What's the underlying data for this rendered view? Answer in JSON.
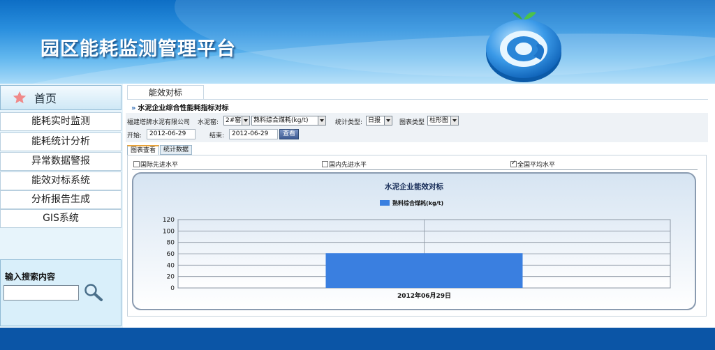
{
  "header": {
    "title": "园区能耗监测管理平台"
  },
  "sidebar": {
    "home_label": "首页",
    "items": [
      {
        "label": "能耗实时监测"
      },
      {
        "label": "能耗统计分析"
      },
      {
        "label": "异常数据警报"
      },
      {
        "label": "能效对标系统"
      },
      {
        "label": "分析报告生成"
      },
      {
        "label": "GIS系统"
      }
    ],
    "search": {
      "label": "输入搜索内容",
      "value": "",
      "placeholder": ""
    }
  },
  "main": {
    "tab_label": "能效对标",
    "subtitle": "水泥企业综合性能耗指标对标",
    "filters": {
      "company": "福建塔牌水泥有限公司",
      "kiln_label": "水泥窑:",
      "kiln_value": "2#窑",
      "indicator_value": "熟料综合煤耗(kg/t)",
      "stat_type_label": "统计类型:",
      "stat_type_value": "日报",
      "chart_type_label": "图表类型",
      "chart_type_value": "柱形图",
      "start_label": "开始:",
      "start_value": "2012-06-29",
      "end_label": "结束:",
      "end_value": "2012-06-29",
      "query_button": "查看"
    },
    "view_tabs": [
      {
        "label": "图表查看",
        "active": true
      },
      {
        "label": "统计数据",
        "active": false
      }
    ],
    "checkboxes": [
      {
        "label": "国际先进水平",
        "checked": false
      },
      {
        "label": "国内先进水平",
        "checked": false
      },
      {
        "label": "全国平均水平",
        "checked": true
      }
    ]
  },
  "chart_data": {
    "type": "bar",
    "title": "水泥企业能效对标",
    "categories": [
      "2012年06月29日"
    ],
    "series": [
      {
        "name": "熟料综合煤耗(kg/t)",
        "values": [
          61
        ],
        "color": "#3a7fe0"
      }
    ],
    "ylim": [
      0,
      120
    ],
    "yticks": [
      0,
      20,
      40,
      60,
      80,
      100,
      120
    ],
    "xlabel": "",
    "ylabel": "",
    "grid": true,
    "legend": "top-center"
  },
  "colors": {
    "header_top": "#0d6ec5",
    "sidebar_bg": "#e7f4fb",
    "footer_bar": "#0b55a6",
    "bar": "#3a7fe0"
  }
}
